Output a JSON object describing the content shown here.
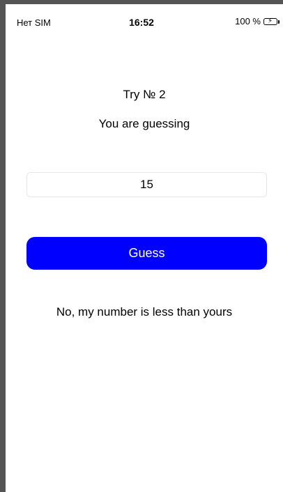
{
  "status_bar": {
    "carrier": "Нет SIM",
    "time": "16:52",
    "battery_text": "100 %",
    "battery_color": "#4cd964"
  },
  "game": {
    "try_label": "Try № 2",
    "status_label": "You are guessing",
    "input_value": "15",
    "guess_button_label": "Guess",
    "result_label": "No, my number is less than yours"
  },
  "colors": {
    "button_bg": "#0000ff",
    "button_text": "#ffffff"
  }
}
